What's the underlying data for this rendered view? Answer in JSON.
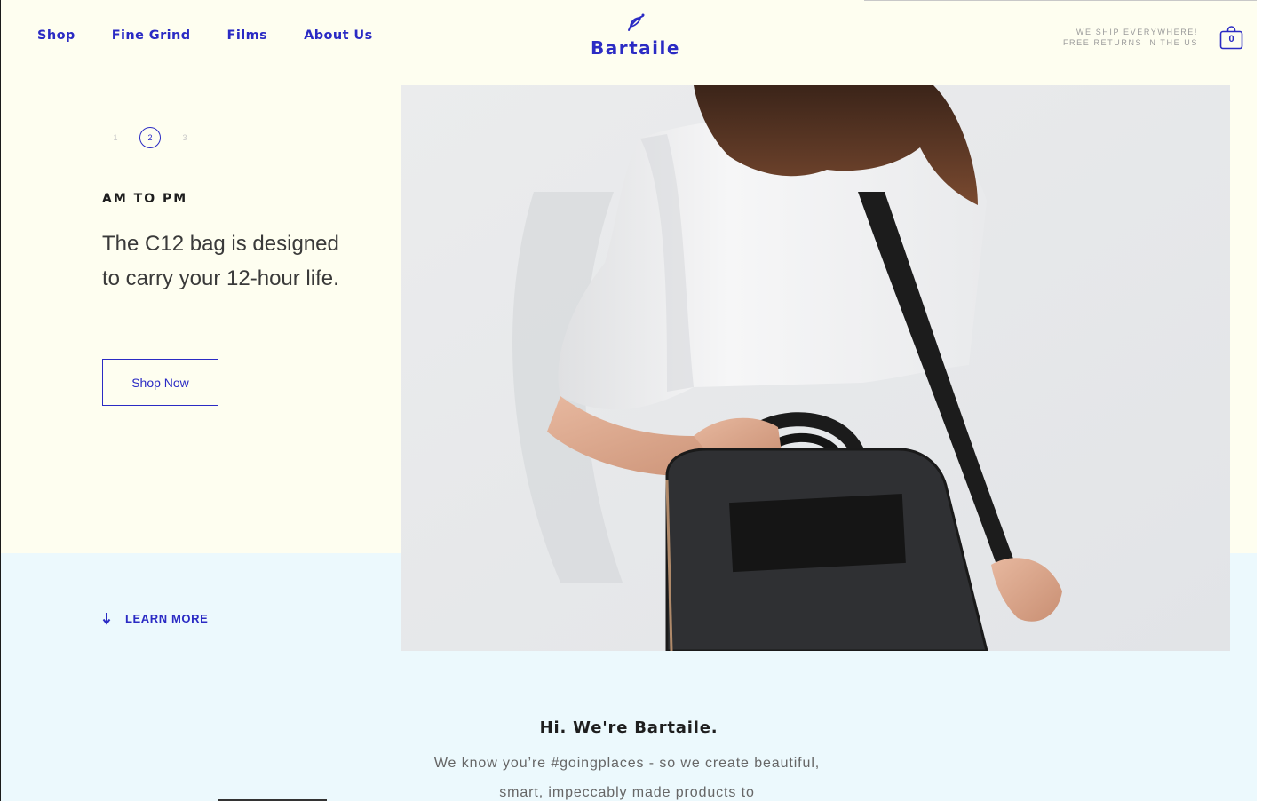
{
  "header": {
    "nav": [
      "Shop",
      "Fine Grind",
      "Films",
      "About Us"
    ],
    "logo_text": "Bartaile",
    "shipping_line1": "WE SHIP EVERYWHERE!",
    "shipping_line2": "FREE RETURNS IN THE US",
    "cart_count": "0"
  },
  "slider": {
    "pages": [
      "1",
      "2",
      "3"
    ],
    "active_page": "2"
  },
  "hero": {
    "kicker": "AM TO PM",
    "headline": "The C12 bag is designed to carry your 12-hour life.",
    "cta_label": "Shop Now"
  },
  "learn_more": "LEARN MORE",
  "intro": {
    "title": "Hi. We're Bartaile.",
    "text": "We know you’re #goingplaces - so we create beautiful, smart, impeccably made products to"
  },
  "colors": {
    "accent": "#2b2bc4",
    "top_background": "#fefef0",
    "bottom_background": "#ecf9fd"
  }
}
